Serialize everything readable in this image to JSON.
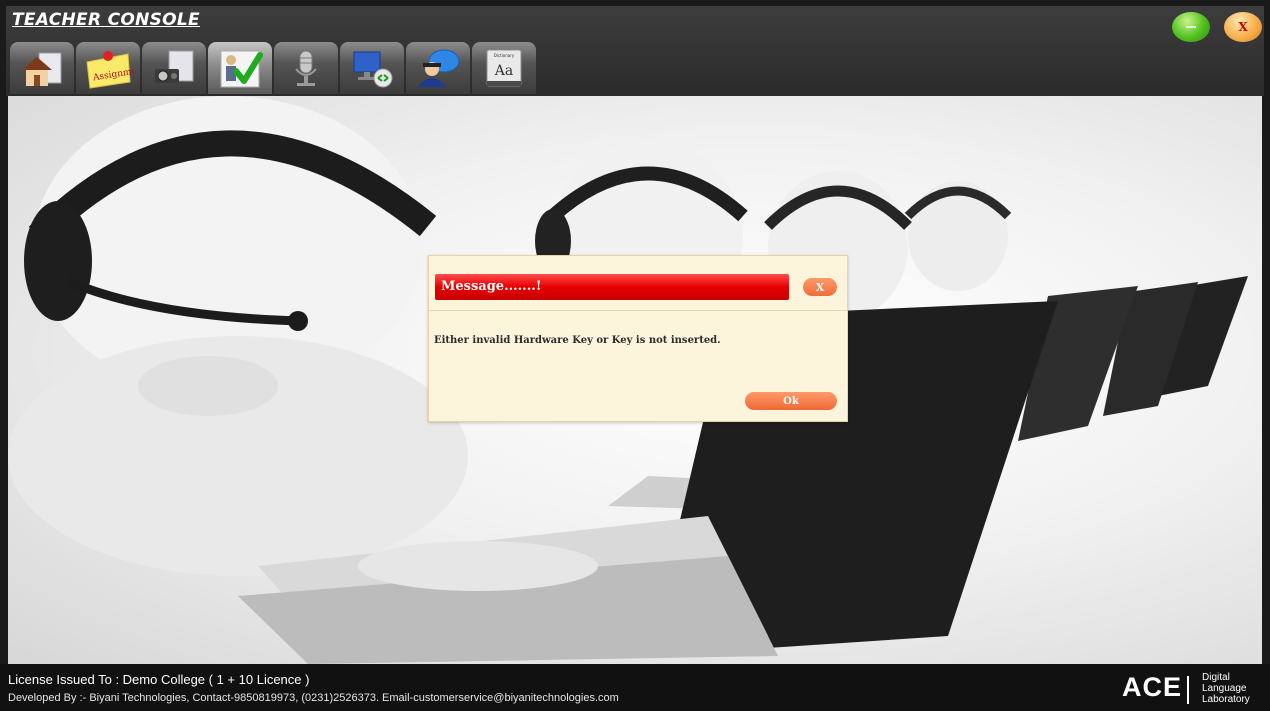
{
  "app": {
    "title": "TEACHER CONSOLE"
  },
  "window_controls": {
    "minimize_label": "-",
    "close_label": "X"
  },
  "toolbar": {
    "items": [
      {
        "name": "home",
        "icon": "home-icon",
        "label": ""
      },
      {
        "name": "assignment",
        "icon": "assignment-icon",
        "label": "Assignment"
      },
      {
        "name": "media",
        "icon": "projector-icon",
        "label": ""
      },
      {
        "name": "attendance",
        "icon": "checkmark-icon",
        "label": ""
      },
      {
        "name": "microphone",
        "icon": "microphone-icon",
        "label": ""
      },
      {
        "name": "remote-desktop",
        "icon": "computer-network-icon",
        "label": ""
      },
      {
        "name": "chat",
        "icon": "chat-user-icon",
        "label": ""
      },
      {
        "name": "dictionary",
        "icon": "dictionary-icon",
        "label": "Aa",
        "sublabel": "Dictionary"
      }
    ]
  },
  "dialog": {
    "title": "Message.......!",
    "close_label": "X",
    "message": "Either invalid Hardware Key or Key is not inserted.",
    "ok_label": "Ok"
  },
  "footer": {
    "license": "License Issued To :   Demo College ( 1 + 10 Licence )",
    "developer": "Developed By :- Biyani Technologies, Contact-9850819973, (0231)2526373. Email-customerservice@biyanitechnologies.com",
    "brand_name": "ACE",
    "brand_sub_1": "Digital",
    "brand_sub_2": "Language",
    "brand_sub_3": "Laboratory"
  },
  "colors": {
    "header_bg": "#333333",
    "dialog_bg": "#fdf4dc",
    "dialog_title_bg": "#e60000",
    "button_orange": "#f06d3a",
    "minimize_green": "#4fc01e",
    "close_orange": "#f6b04c"
  }
}
